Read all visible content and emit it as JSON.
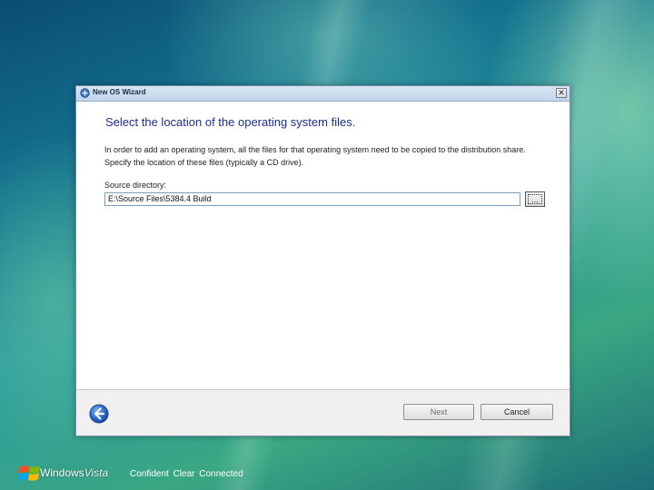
{
  "window": {
    "title": "New OS Wizard",
    "close_glyph": "✕"
  },
  "page": {
    "heading": "Select the location of the operating system files.",
    "intro": "In order to add an operating system, all the files for that operating system need to be copied to the distribution share. Specify the location of these files (typically a CD drive).",
    "source_label": "Source directory:",
    "source_value": "E:\\Source Files\\5384.4 Build",
    "browse_label": "..."
  },
  "footer": {
    "back_icon": "back-arrow-icon",
    "next_label": "Next",
    "next_enabled": false,
    "cancel_label": "Cancel"
  },
  "desktop": {
    "brand": "Windows",
    "brand_suffix": "Vista",
    "tagline": "Confident  Clear  Connected"
  },
  "colors": {
    "heading": "#1c2f8a",
    "back_button": "#2a6bd1",
    "title_bar": "#c2d4ea"
  }
}
